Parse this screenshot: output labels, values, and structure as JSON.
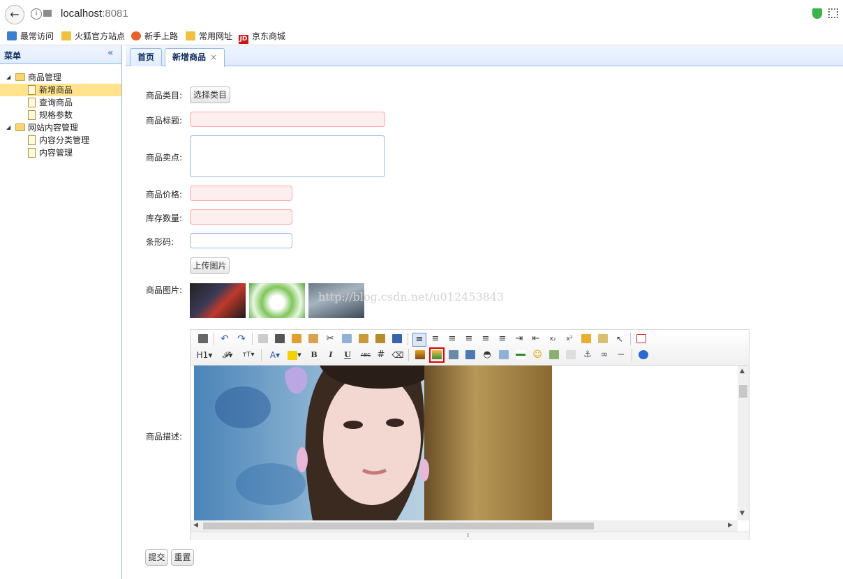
{
  "browser": {
    "url_host": "localhost",
    "url_port": ":8081",
    "bookmarks": [
      "最常访问",
      "火狐官方站点",
      "新手上路",
      "常用网址",
      "京东商城"
    ]
  },
  "west": {
    "title": "菜单",
    "tree": [
      {
        "label": "商品管理",
        "type": "folder"
      },
      {
        "label": "新增商品",
        "type": "leaf",
        "selected": true
      },
      {
        "label": "查询商品",
        "type": "leaf"
      },
      {
        "label": "规格参数",
        "type": "leaf"
      },
      {
        "label": "网站内容管理",
        "type": "folder"
      },
      {
        "label": "内容分类管理",
        "type": "leaf"
      },
      {
        "label": "内容管理",
        "type": "leaf"
      }
    ]
  },
  "tabs": [
    {
      "label": "首页",
      "active": false
    },
    {
      "label": "新增商品",
      "active": true,
      "close": "×"
    }
  ],
  "form": {
    "category_label": "商品类目:",
    "category_button": "选择类目",
    "title_label": "商品标题:",
    "sellpoint_label": "商品卖点:",
    "price_label": "商品价格:",
    "stock_label": "库存数量:",
    "barcode_label": "条形码:",
    "upload_button": "上传图片",
    "images_label": "商品图片:",
    "desc_label": "商品描述:",
    "submit_button": "提交",
    "reset_button": "重置"
  },
  "watermark": "http://blog.csdn.net/u012453843",
  "editor": {
    "row2_text": {
      "h1": "H1",
      "font": "𝓕",
      "size": "тT",
      "bold": "B",
      "italic": "I",
      "underline": "U",
      "strike": "ABC"
    }
  },
  "colors": {
    "accent": "#95b8e7",
    "selected": "#ffe48d",
    "required_bg": "#ffeeee",
    "highlight": "#e60000"
  }
}
